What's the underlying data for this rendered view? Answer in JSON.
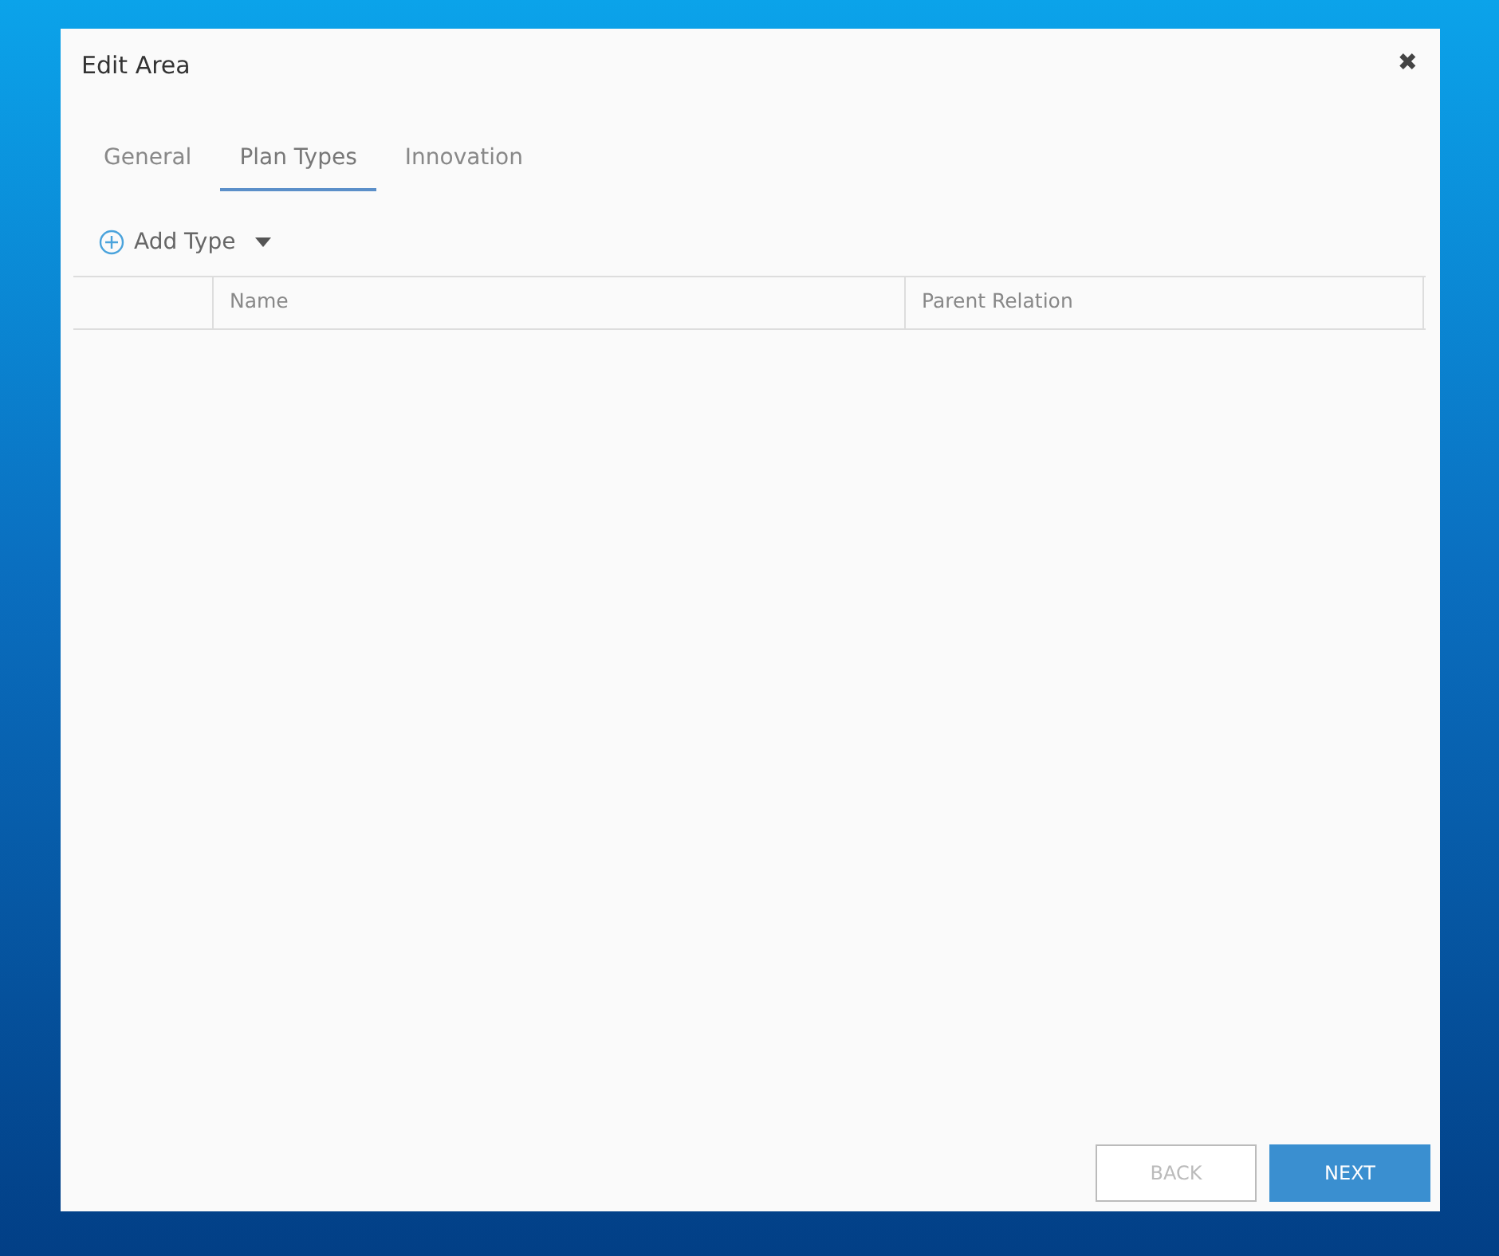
{
  "dialog": {
    "title": "Edit Area",
    "close": "✖"
  },
  "tabs": [
    {
      "label": "General",
      "selected": false
    },
    {
      "label": "Plan Types",
      "selected": true
    },
    {
      "label": "Innovation",
      "selected": false
    }
  ],
  "toolbar": {
    "add_button": "Add Type"
  },
  "table": {
    "columns": [
      "Name",
      "Parent Relation"
    ]
  },
  "buttons": [
    {
      "label": "BACK",
      "kind": "secondary",
      "disabled": true
    },
    {
      "label": "NEXT",
      "kind": "primary",
      "disabled": false
    }
  ]
}
